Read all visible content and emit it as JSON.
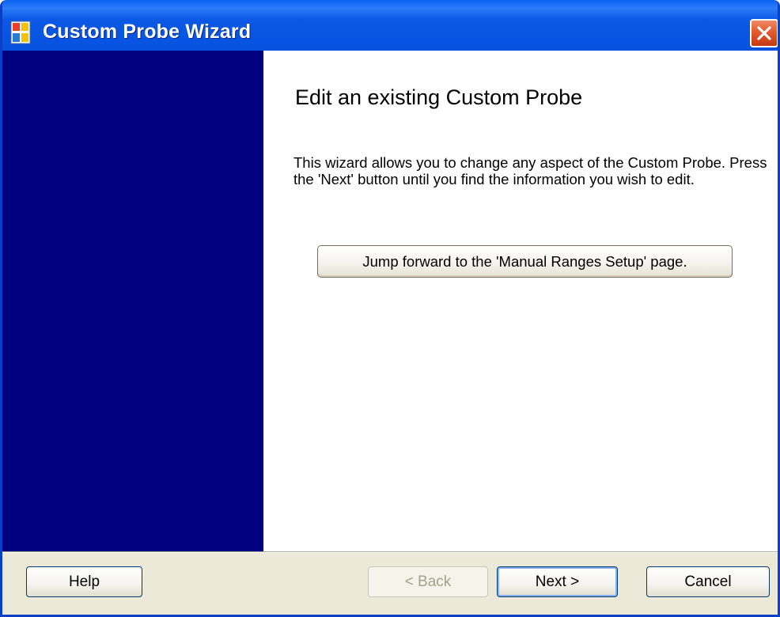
{
  "window": {
    "title": "Custom Probe Wizard",
    "app_icon": "wizard-app-icon",
    "close_icon": "close-icon"
  },
  "colors": {
    "titlebar": "#0553e0",
    "left_panel": "#000080",
    "content_bg": "#ffffff",
    "dialog_bg": "#ece9d8",
    "close_button": "#e25a2e"
  },
  "page": {
    "title": "Edit an existing Custom Probe",
    "description": "This wizard allows you to change any aspect of the Custom Probe. Press the 'Next' button until you find the information you wish to edit.",
    "jump_button_label": "Jump forward to the 'Manual Ranges Setup' page."
  },
  "footer": {
    "help_label": "Help",
    "back_label": "< Back",
    "back_enabled": false,
    "next_label": "Next >",
    "cancel_label": "Cancel"
  }
}
